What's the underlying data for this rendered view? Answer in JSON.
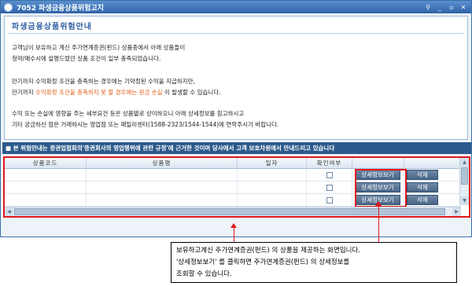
{
  "window": {
    "title": "7052 파생금융상품위험고지",
    "controls": [
      "pin-icon",
      "minimize-icon",
      "restore-icon",
      "close-icon"
    ],
    "control_glyphs": [
      "⚲",
      "_",
      "▫",
      "✕"
    ]
  },
  "notice": {
    "heading": "파생금융상품위험안내",
    "para1": [
      "고객님이 보유하고 계신 주가연계증권(펀드) 상품중에서 아래 상품들이",
      "청약/매수시에 설명드렸던 상품 조건이 일부 충족되었습니다."
    ],
    "para2_line1": "만기까지 수익확정 조건을 충족하는 경우에는 기약정된 수익을 지급하지만,",
    "para2_line2_pre": "만기까지 ",
    "para2_line2_warn": "수익확정 조건을 충족하지 못 할 경우에는 원금 손실",
    "para2_line2_post": "이 발생할 수 있습니다.",
    "para3": [
      "수익 또는 손실에 영향을 주는 세부요건 등은 상품별로 상이하오니 아래 상세정보를 참고하시고",
      "기타 궁금하신 점은 거래하시는 영업점 또는 패밀리센터(1588-2323/1544-1544)에 연락주시기 바랍니다."
    ]
  },
  "banner": {
    "text": "■ 본 위험안내는 증권업협회의'증권회사의 영업행위에 관한 규정'에 근거한 것이며 당사에서 고객 보호차원에서 안내드리고 있습니다"
  },
  "grid": {
    "columns": [
      "상품코드",
      "상품명",
      "일자",
      "확인여부",
      "",
      ""
    ],
    "rows": [
      {
        "code": "",
        "name": "",
        "date": "",
        "detail_label": "상세정보보기",
        "delete_label": "삭제"
      },
      {
        "code": "",
        "name": "",
        "date": "",
        "detail_label": "상세정보보기",
        "delete_label": "삭제"
      },
      {
        "code": "",
        "name": "",
        "date": "",
        "detail_label": "상세정보보기",
        "delete_label": "삭제"
      }
    ]
  },
  "callout": {
    "lines": [
      "보유하고계신 주가연계증권(펀드) 의 상품을 제공하는 화면입니다.",
      "'상세정보보기' 를 클릭하면 주가연계증권(펀드) 의 상세정보를",
      "조회할 수 있습니다."
    ]
  },
  "colors": {
    "accent": "#2c5fa4",
    "banner_bg": "#2c5a8c",
    "highlight": "#e0181e",
    "warning_text": "#e0601b",
    "button_bg": "#4a6687"
  }
}
